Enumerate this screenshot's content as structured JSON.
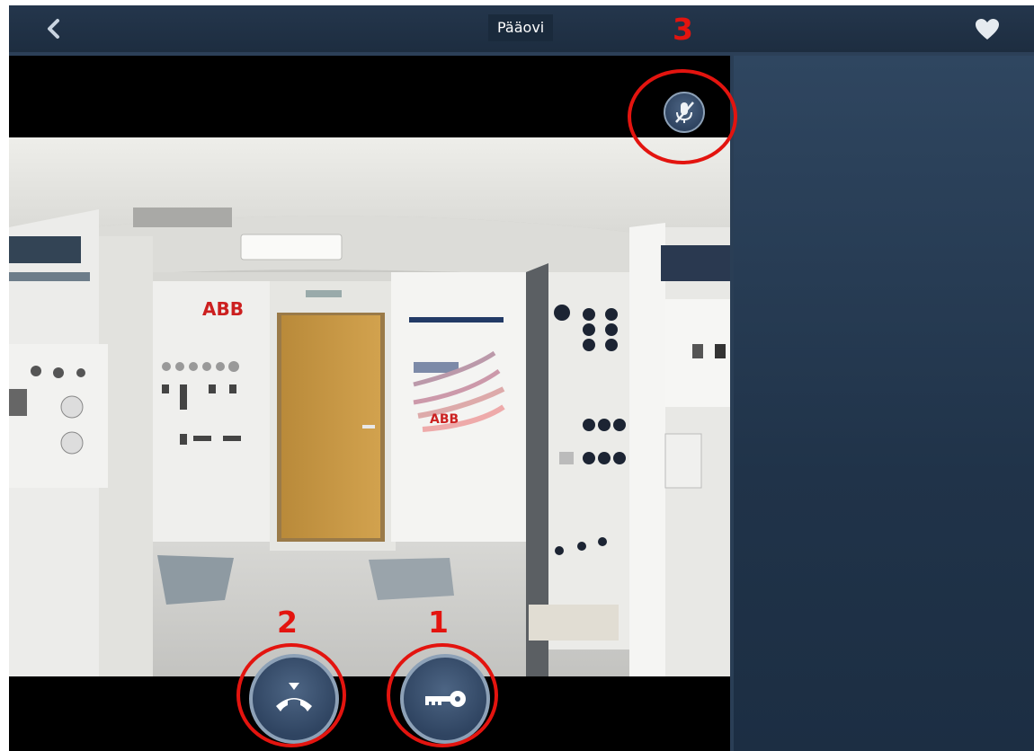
{
  "header": {
    "title": "Pääovi",
    "back_icon": "chevron-left-icon",
    "favorite_icon": "heart-icon"
  },
  "video": {
    "wall_logo_text": "ABB"
  },
  "controls": {
    "mute_icon": "microphone-muted-icon",
    "hangup_icon": "hang-up-icon",
    "unlock_icon": "key-icon"
  },
  "annotations": {
    "unlock_marker": "1",
    "hangup_marker": "2",
    "mute_marker": "3"
  },
  "colors": {
    "topbar": "#1f3045",
    "right_panel": "#263b53",
    "button_fill": "#3e5573",
    "annotation_red": "#e3140f"
  }
}
